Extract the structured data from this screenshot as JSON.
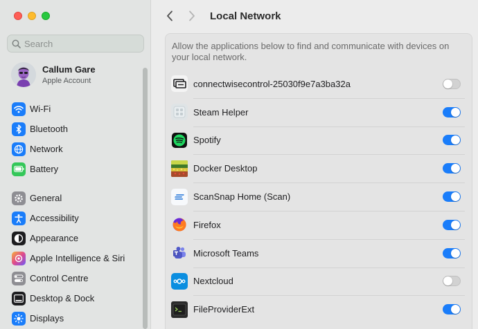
{
  "window": {
    "title": "Local Network"
  },
  "search": {
    "placeholder": "Search"
  },
  "account": {
    "name": "Callum Gare",
    "subtitle": "Apple Account"
  },
  "sidebar": {
    "group1": [
      {
        "label": "Wi-Fi",
        "icon": "wifi-icon",
        "color": "#1a7dfa"
      },
      {
        "label": "Bluetooth",
        "icon": "bluetooth-icon",
        "color": "#1a7dfa"
      },
      {
        "label": "Network",
        "icon": "globe-icon",
        "color": "#1a7dfa"
      },
      {
        "label": "Battery",
        "icon": "battery-icon",
        "color": "#34c759"
      }
    ],
    "group2": [
      {
        "label": "General",
        "icon": "gear-icon",
        "color": "#8e8e93"
      },
      {
        "label": "Accessibility",
        "icon": "accessibility-icon",
        "color": "#1a7dfa"
      },
      {
        "label": "Appearance",
        "icon": "appearance-icon",
        "color": "#1d1d1f"
      },
      {
        "label": "Apple Intelligence & Siri",
        "icon": "siri-icon",
        "color": "#e0498c"
      },
      {
        "label": "Control Centre",
        "icon": "control-centre-icon",
        "color": "#8e8e93"
      },
      {
        "label": "Desktop & Dock",
        "icon": "dock-icon",
        "color": "#1d1d1f"
      },
      {
        "label": "Displays",
        "icon": "sun-icon",
        "color": "#1a7dfa"
      }
    ]
  },
  "main": {
    "description": "Allow the applications below to find and communicate with devices on your local network.",
    "apps": [
      {
        "name": "connectwisecontrol-25030f9e7a3ba32a",
        "enabled": false,
        "icon": "connectwise-icon"
      },
      {
        "name": "Steam Helper",
        "enabled": true,
        "icon": "steam-helper-icon"
      },
      {
        "name": "Spotify",
        "enabled": true,
        "icon": "spotify-icon"
      },
      {
        "name": "Docker Desktop",
        "enabled": true,
        "icon": "docker-icon"
      },
      {
        "name": "ScanSnap Home (Scan)",
        "enabled": true,
        "icon": "scansnap-icon"
      },
      {
        "name": "Firefox",
        "enabled": true,
        "icon": "firefox-icon"
      },
      {
        "name": "Microsoft Teams",
        "enabled": true,
        "icon": "teams-icon"
      },
      {
        "name": "Nextcloud",
        "enabled": false,
        "icon": "nextcloud-icon"
      },
      {
        "name": "FileProviderExt",
        "enabled": true,
        "icon": "terminal-icon"
      }
    ]
  }
}
